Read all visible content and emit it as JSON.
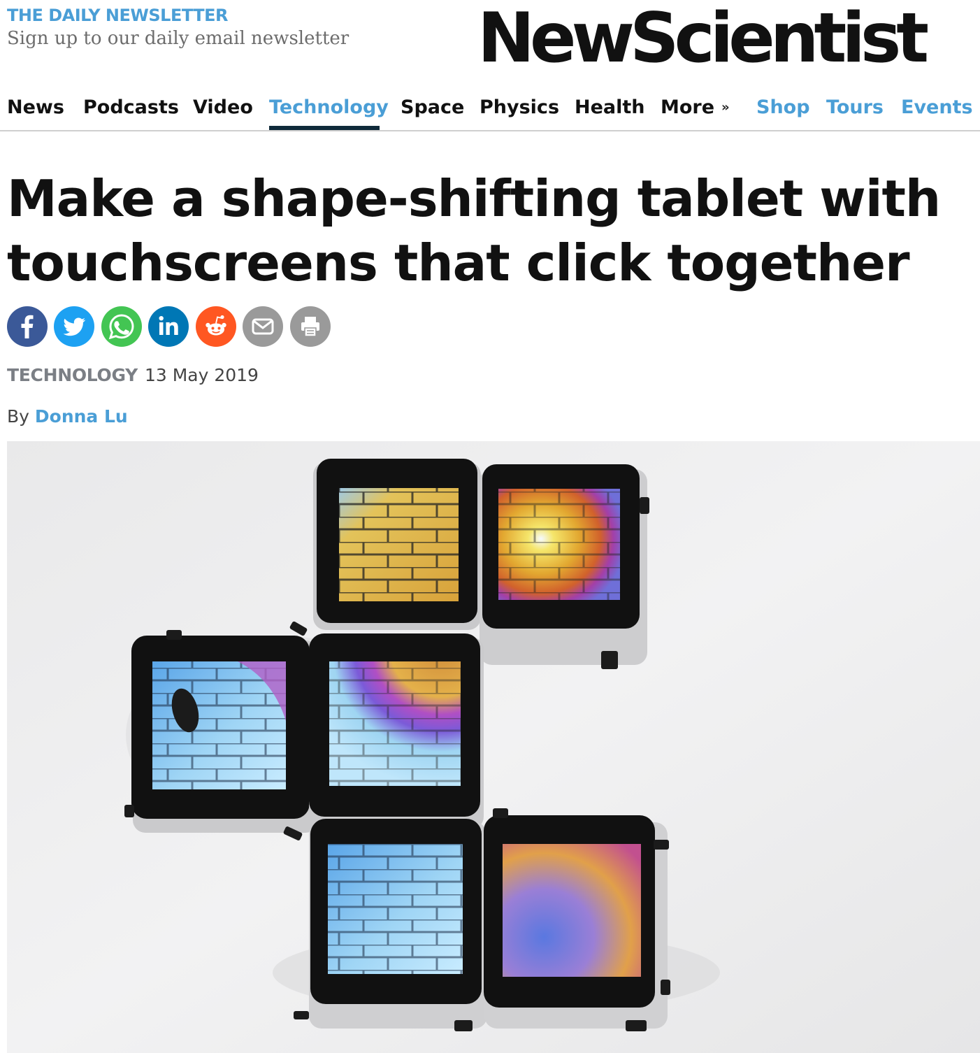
{
  "newsletter": {
    "title": "THE DAILY NEWSLETTER",
    "subtitle": "Sign up to our daily email newsletter"
  },
  "brand": {
    "logo": "NewScientist"
  },
  "nav": {
    "items": [
      {
        "label": "News"
      },
      {
        "label": "Podcasts"
      },
      {
        "label": "Video"
      },
      {
        "label": "Technology",
        "active": true
      },
      {
        "label": "Space"
      },
      {
        "label": "Physics"
      },
      {
        "label": "Health"
      },
      {
        "label": "More"
      },
      {
        "label": "Shop"
      },
      {
        "label": "Tours"
      },
      {
        "label": "Events"
      }
    ]
  },
  "article": {
    "title": "Make a shape-shifting tablet with touchscreens that click together",
    "section": "TECHNOLOGY",
    "date": "13 May 2019",
    "by": "By",
    "author": "Donna Lu"
  },
  "share": [
    {
      "icon": "facebook-icon",
      "color": "#3b5998"
    },
    {
      "icon": "twitter-icon",
      "color": "#1da1f2"
    },
    {
      "icon": "whatsapp-icon",
      "color": "#43c553"
    },
    {
      "icon": "linkedin-icon",
      "color": "#0077b5"
    },
    {
      "icon": "reddit-icon",
      "color": "#ff5722"
    },
    {
      "icon": "email-icon",
      "color": "#9a9a9a"
    },
    {
      "icon": "print-icon",
      "color": "#9a9a9a"
    }
  ],
  "colors": {
    "accent": "#4a9ed6",
    "nav_active_underline": "#0f2a3a"
  }
}
